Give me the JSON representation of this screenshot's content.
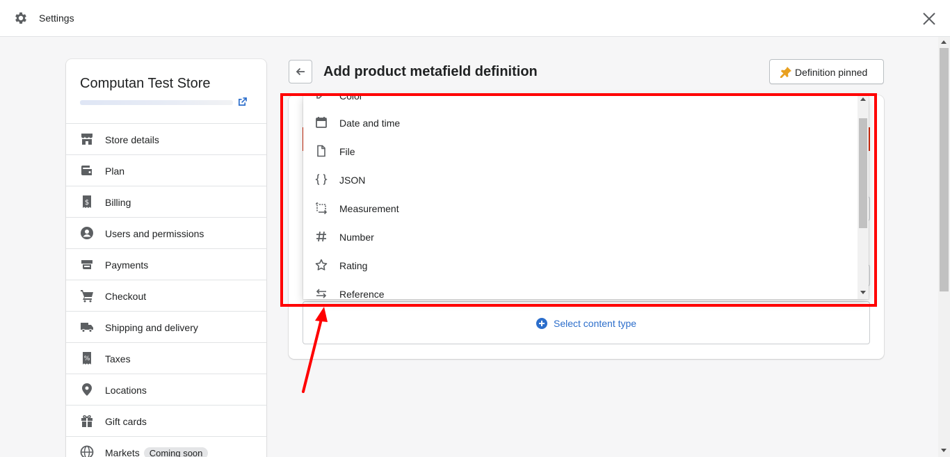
{
  "window": {
    "title": "Settings"
  },
  "store": {
    "name": "Computan Test Store"
  },
  "nav": [
    {
      "label": "Store details",
      "icon": "store-icon"
    },
    {
      "label": "Plan",
      "icon": "wallet-icon"
    },
    {
      "label": "Billing",
      "icon": "receipt-icon"
    },
    {
      "label": "Users and permissions",
      "icon": "user-icon"
    },
    {
      "label": "Payments",
      "icon": "payments-icon"
    },
    {
      "label": "Checkout",
      "icon": "cart-icon"
    },
    {
      "label": "Shipping and delivery",
      "icon": "truck-icon"
    },
    {
      "label": "Taxes",
      "icon": "tax-icon"
    },
    {
      "label": "Locations",
      "icon": "location-icon"
    },
    {
      "label": "Gift cards",
      "icon": "gift-icon"
    },
    {
      "label": "Markets",
      "icon": "globe-icon",
      "badge": "Coming soon"
    }
  ],
  "header": {
    "title": "Add product metafield definition",
    "pin_button": "Definition pinned"
  },
  "dropdown": {
    "partial_top": "Color",
    "items": [
      {
        "label": "Date and time",
        "icon": "calendar-icon"
      },
      {
        "label": "File",
        "icon": "file-icon"
      },
      {
        "label": "JSON",
        "icon": "json-braces-icon"
      },
      {
        "label": "Measurement",
        "icon": "measurement-icon"
      },
      {
        "label": "Number",
        "icon": "hash-icon"
      },
      {
        "label": "Rating",
        "icon": "star-icon"
      },
      {
        "label": "Reference",
        "icon": "reference-arrows-icon"
      }
    ]
  },
  "select_content": {
    "label": "Select content type"
  },
  "colors": {
    "accent": "#2c6ecb",
    "annotation": "#ff0000",
    "pin": "#e8a020"
  }
}
